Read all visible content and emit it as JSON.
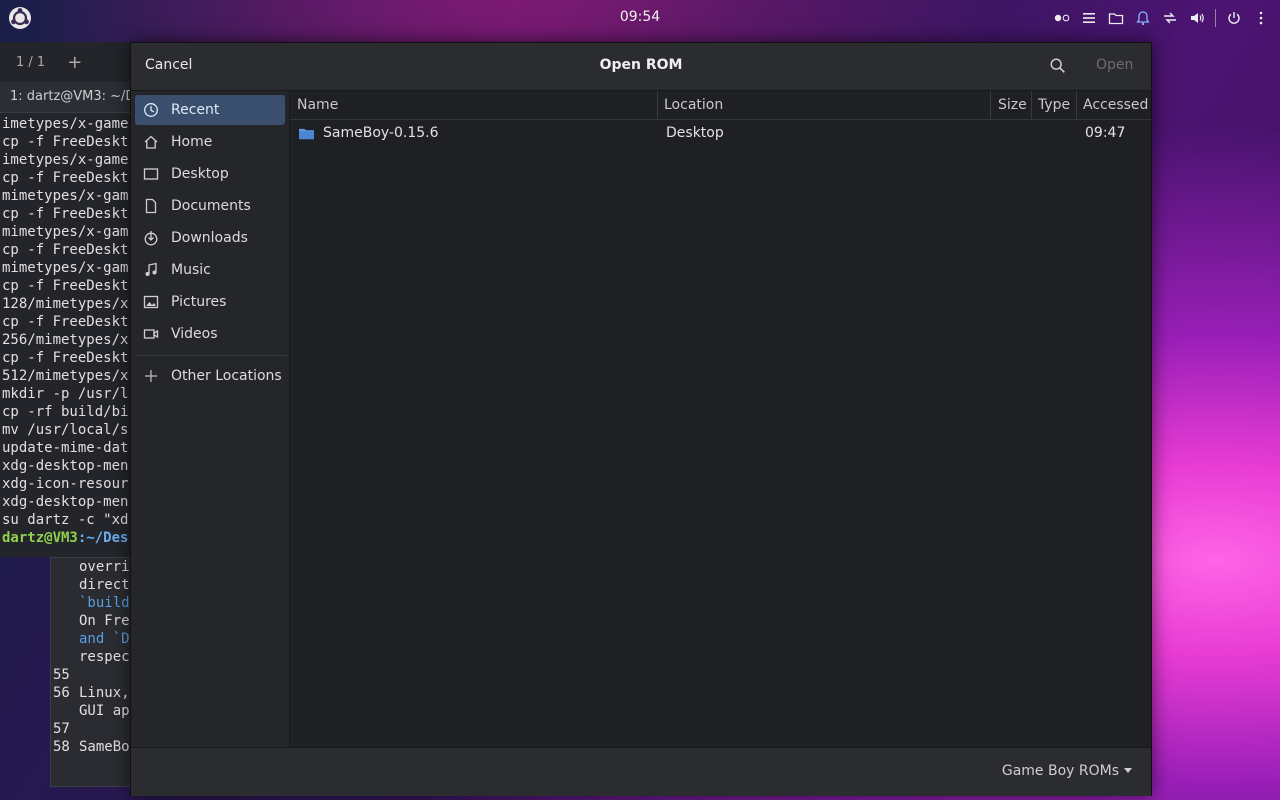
{
  "topbar": {
    "clock": "09:54"
  },
  "terminal": {
    "tab_counter": "1 / 1",
    "tab_title": "1: dartz@VM3: ~/D",
    "lines": [
      "imetypes/x-game",
      "cp -f FreeDeskt",
      "imetypes/x-game",
      "cp -f FreeDeskt",
      "mimetypes/x-gam",
      "cp -f FreeDeskt",
      "mimetypes/x-gam",
      "cp -f FreeDeskt",
      "mimetypes/x-gam",
      "cp -f FreeDeskt",
      "128/mimetypes/x",
      "cp -f FreeDeskt",
      "256/mimetypes/x",
      "cp -f FreeDeskt",
      "512/mimetypes/x",
      "mkdir -p /usr/l",
      "cp -rf build/bi",
      "mv /usr/local/s",
      "update-mime-dat",
      "xdg-desktop-men",
      "xdg-icon-resour",
      "xdg-desktop-men",
      "su dartz -c \"xd"
    ],
    "prompt_user": "dartz@VM3",
    "prompt_path": ":~/Des"
  },
  "editor": {
    "lines": [
      {
        "num": "",
        "text": "overri"
      },
      {
        "num": "",
        "text": "direct"
      },
      {
        "num": "",
        "text": "`build"
      },
      {
        "num": "",
        "text": "On Fre"
      },
      {
        "num": "",
        "text": "and `D"
      },
      {
        "num": "",
        "text": "respec"
      },
      {
        "num": "55",
        "text": ""
      },
      {
        "num": "56",
        "text": "Linux,"
      },
      {
        "num": "",
        "text": "GUI ap"
      },
      {
        "num": "57",
        "text": ""
      },
      {
        "num": "58",
        "text": "SameBo"
      }
    ]
  },
  "dialog": {
    "cancel_label": "Cancel",
    "title": "Open ROM",
    "open_label": "Open",
    "sidebar": [
      {
        "label": "Recent",
        "icon": "clock-icon"
      },
      {
        "label": "Home",
        "icon": "home-icon"
      },
      {
        "label": "Desktop",
        "icon": "desktop-icon"
      },
      {
        "label": "Documents",
        "icon": "document-icon"
      },
      {
        "label": "Downloads",
        "icon": "download-icon"
      },
      {
        "label": "Music",
        "icon": "music-icon"
      },
      {
        "label": "Pictures",
        "icon": "picture-icon"
      },
      {
        "label": "Videos",
        "icon": "video-icon"
      }
    ],
    "other_locations": "Other Locations",
    "columns": [
      "Name",
      "Location",
      "Size",
      "Type",
      "Accessed"
    ],
    "files": [
      {
        "name": "SameBoy-0.15.6",
        "location": "Desktop",
        "size": "",
        "type": "",
        "accessed": "09:47",
        "icon": "folder-icon"
      }
    ],
    "filter": "Game Boy ROMs",
    "accent": "#3a4f6e"
  }
}
